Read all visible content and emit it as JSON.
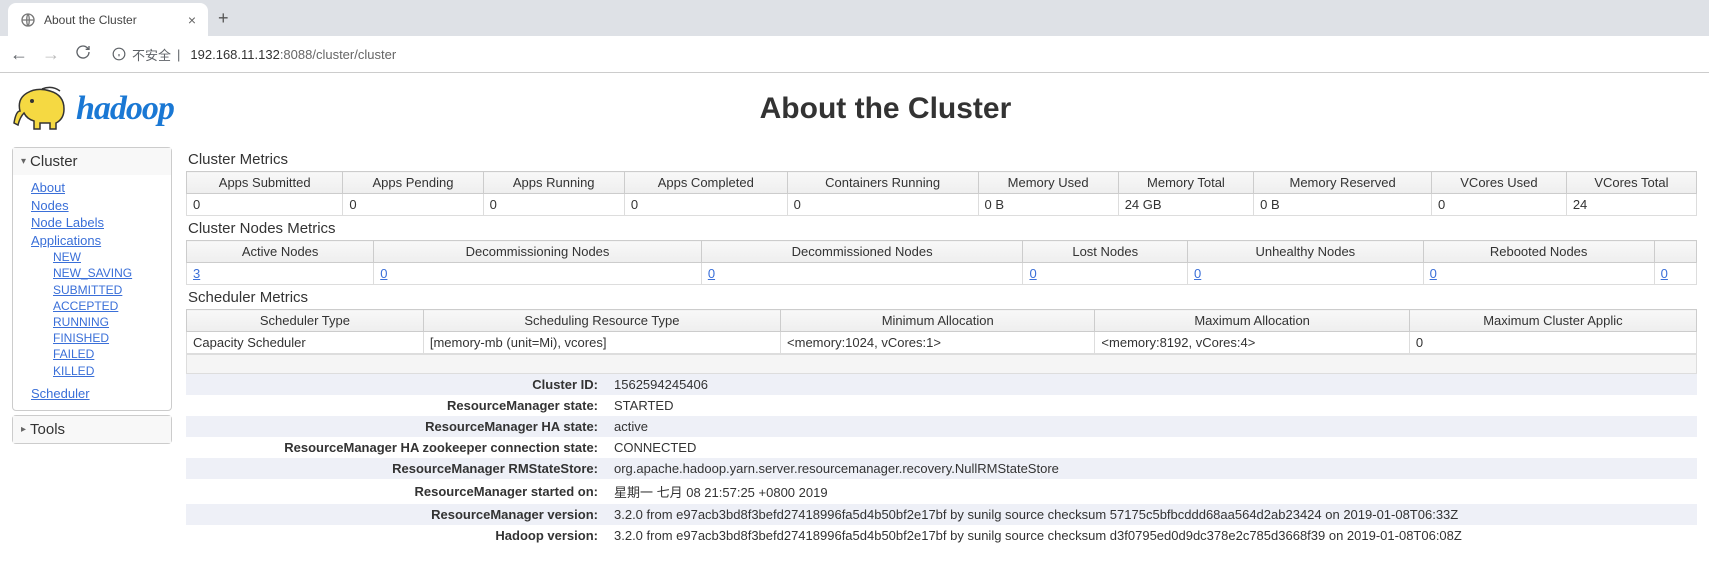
{
  "browser": {
    "tab_title": "About the Cluster",
    "security_label": "不安全",
    "url_host": "192.168.11.132",
    "url_path": ":8088/cluster/cluster"
  },
  "header": {
    "logo_text": "hadoop",
    "title": "About the Cluster"
  },
  "sidebar": {
    "cluster": {
      "label": "Cluster",
      "items": [
        {
          "label": "About"
        },
        {
          "label": "Nodes"
        },
        {
          "label": "Node Labels"
        },
        {
          "label": "Applications"
        }
      ],
      "app_states": [
        {
          "label": "NEW"
        },
        {
          "label": "NEW_SAVING"
        },
        {
          "label": "SUBMITTED"
        },
        {
          "label": "ACCEPTED"
        },
        {
          "label": "RUNNING"
        },
        {
          "label": "FINISHED"
        },
        {
          "label": "FAILED"
        },
        {
          "label": "KILLED"
        }
      ],
      "scheduler": {
        "label": "Scheduler"
      }
    },
    "tools": {
      "label": "Tools"
    }
  },
  "cluster_metrics": {
    "title": "Cluster Metrics",
    "headers": [
      "Apps Submitted",
      "Apps Pending",
      "Apps Running",
      "Apps Completed",
      "Containers Running",
      "Memory Used",
      "Memory Total",
      "Memory Reserved",
      "VCores Used",
      "VCores Total"
    ],
    "row": [
      "0",
      "0",
      "0",
      "0",
      "0",
      "0 B",
      "24 GB",
      "0 B",
      "0",
      "24"
    ]
  },
  "nodes_metrics": {
    "title": "Cluster Nodes Metrics",
    "headers": [
      "Active Nodes",
      "Decommissioning Nodes",
      "Decommissioned Nodes",
      "Lost Nodes",
      "Unhealthy Nodes",
      "Rebooted Nodes",
      ""
    ],
    "row": [
      "3",
      "0",
      "0",
      "0",
      "0",
      "0",
      "0"
    ]
  },
  "scheduler_metrics": {
    "title": "Scheduler Metrics",
    "headers": [
      "Scheduler Type",
      "Scheduling Resource Type",
      "Minimum Allocation",
      "Maximum Allocation",
      "Maximum Cluster Applic"
    ],
    "row": [
      "Capacity Scheduler",
      "[memory-mb (unit=Mi), vcores]",
      "<memory:1024, vCores:1>",
      "<memory:8192, vCores:4>",
      "0"
    ]
  },
  "info": [
    {
      "k": "Cluster ID:",
      "v": "1562594245406"
    },
    {
      "k": "ResourceManager state:",
      "v": "STARTED"
    },
    {
      "k": "ResourceManager HA state:",
      "v": "active"
    },
    {
      "k": "ResourceManager HA zookeeper connection state:",
      "v": "CONNECTED"
    },
    {
      "k": "ResourceManager RMStateStore:",
      "v": "org.apache.hadoop.yarn.server.resourcemanager.recovery.NullRMStateStore"
    },
    {
      "k": "ResourceManager started on:",
      "v": "星期一 七月 08 21:57:25 +0800 2019"
    },
    {
      "k": "ResourceManager version:",
      "v": "3.2.0 from e97acb3bd8f3befd27418996fa5d4b50bf2e17bf by sunilg source checksum 57175c5bfbcddd68aa564d2ab23424 on 2019-01-08T06:33Z"
    },
    {
      "k": "Hadoop version:",
      "v": "3.2.0 from e97acb3bd8f3befd27418996fa5d4b50bf2e17bf by sunilg source checksum d3f0795ed0d9dc378e2c785d3668f39 on 2019-01-08T06:08Z"
    }
  ]
}
